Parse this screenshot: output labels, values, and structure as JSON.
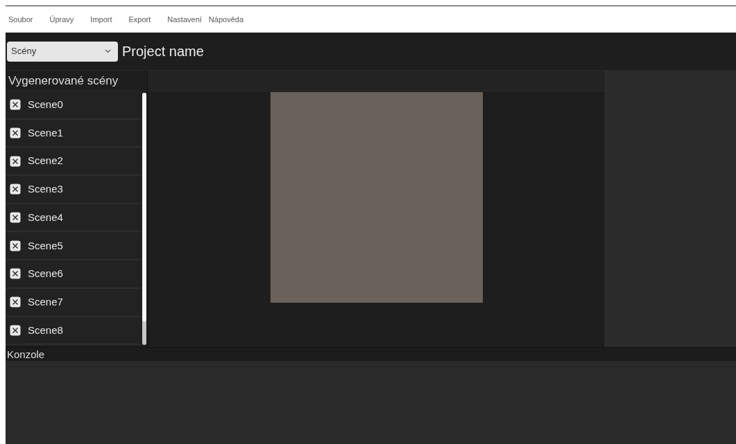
{
  "menu": [
    "Soubor",
    "Úpravy",
    "Import",
    "Export",
    "Nastavení",
    "Nápověda"
  ],
  "toolbar": {
    "scene_select": "Scény",
    "project_name": "Project name"
  },
  "scene_panel": {
    "title": "Vygenerované scény",
    "scenes": [
      {
        "label": "Scene0",
        "checked": true
      },
      {
        "label": "Scene1",
        "checked": true
      },
      {
        "label": "Scene2",
        "checked": true
      },
      {
        "label": "Scene3",
        "checked": true
      },
      {
        "label": "Scene4",
        "checked": true
      },
      {
        "label": "Scene5",
        "checked": true
      },
      {
        "label": "Scene6",
        "checked": true
      },
      {
        "label": "Scene7",
        "checked": true
      },
      {
        "label": "Scene8",
        "checked": true
      }
    ]
  },
  "console": {
    "title": "Konzole"
  }
}
